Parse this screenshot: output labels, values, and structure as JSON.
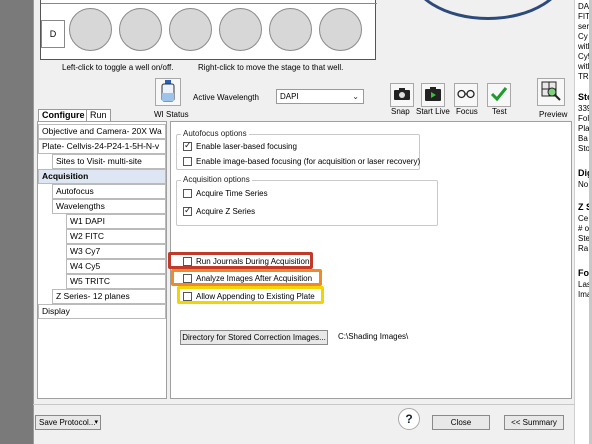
{
  "plate": {
    "row_label": "D",
    "hint_left": "Left-click to toggle a well on/off.",
    "hint_right": "Right-click to move the stage to that well."
  },
  "toolbar": {
    "wi_status_label": "WI Status",
    "active_wavelength_label": "Active Wavelength",
    "active_wavelength_value": "DAPI",
    "snap_label": "Snap",
    "start_live_label": "Start Live",
    "focus_label": "Focus",
    "test_label": "Test",
    "preview_label": "Preview"
  },
  "tabs": [
    {
      "label": "Configure"
    },
    {
      "label": "Run"
    }
  ],
  "tree": [
    {
      "label": "Objective and Camera- 20X Wa"
    },
    {
      "label": "Plate- Cellvis-24-P24-1-5H-N-v"
    },
    {
      "label": "Sites to Visit- multi-site"
    },
    {
      "label": "Acquisition"
    },
    {
      "label": "Autofocus"
    },
    {
      "label": "Wavelengths"
    },
    {
      "label": "W1 DAPI"
    },
    {
      "label": "W2 FITC"
    },
    {
      "label": "W3 Cy7"
    },
    {
      "label": "W4 Cy5"
    },
    {
      "label": "W5 TRITC"
    },
    {
      "label": "Z Series- 12 planes"
    },
    {
      "label": "Display"
    }
  ],
  "autofocus": {
    "legend": "Autofocus options",
    "laser_label": "Enable laser-based focusing",
    "laser_checked": true,
    "image_label": "Enable image-based focusing (for acquisition or laser recovery)",
    "image_checked": false
  },
  "acquisition": {
    "legend": "Acquisition options",
    "time_series_label": "Acquire Time Series",
    "time_series_checked": false,
    "z_series_label": "Acquire Z Series",
    "z_series_checked": true
  },
  "options": {
    "run_journals_label": "Run Journals During Acquisition",
    "analyze_label": "Analyze Images After Acquisition",
    "allow_append_label": "Allow Appending to Existing Plate",
    "highlight_colors": [
      "#c0392b",
      "#f0892a",
      "#f2d400"
    ]
  },
  "directory": {
    "button_label": "Directory for Stored Correction Images...",
    "path": "C:\\Shading Images\\"
  },
  "footer": {
    "save_protocol": "Save Protocol...",
    "close": "Close",
    "summary": "<< Summary"
  },
  "right_panel": {
    "lines": [
      "DA",
      "FIT",
      "ser",
      "Cy",
      "with",
      "Cy5",
      "with",
      "TR",
      "Sto",
      "339",
      "Fol",
      "Pla",
      "Ba",
      "Sto",
      "Dig",
      "No",
      "Z S",
      "Ce",
      "# o",
      "Ste",
      "Ra",
      "Fo",
      "Las",
      "Ima"
    ]
  },
  "colors": {
    "accent_blue": "#2c4a7a",
    "test_green": "#1e9c2a"
  }
}
